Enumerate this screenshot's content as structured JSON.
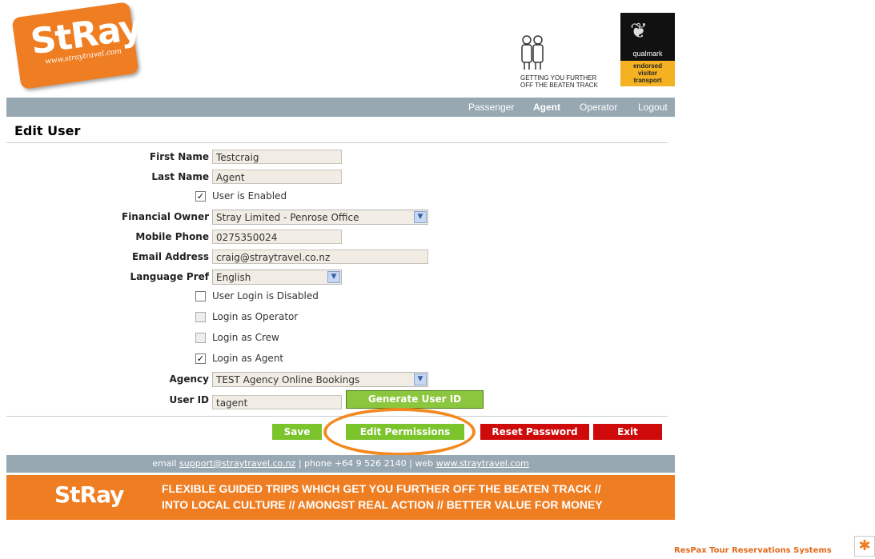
{
  "header": {
    "logo_text": "StRay",
    "logo_url": "www.straytravel.com",
    "tagline_line1": "GETTING YOU FURTHER",
    "tagline_line2": "OFF THE BEATEN TRACK",
    "qualmark_name": "qualmark",
    "qualmark_line1": "endorsed",
    "qualmark_line2": "visitor",
    "qualmark_line3": "transport"
  },
  "nav": {
    "items": [
      {
        "label": "Passenger"
      },
      {
        "label": "Agent"
      },
      {
        "label": "Operator"
      },
      {
        "label": "Logout"
      }
    ],
    "active": "Agent"
  },
  "page": {
    "title": "Edit User"
  },
  "form": {
    "first_name": {
      "label": "First Name",
      "value": "Testcraig"
    },
    "last_name": {
      "label": "Last Name",
      "value": "Agent"
    },
    "user_enabled": {
      "label": "User is Enabled",
      "checked": true
    },
    "financial_owner": {
      "label": "Financial Owner",
      "value": "Stray Limited - Penrose Office"
    },
    "mobile_phone": {
      "label": "Mobile Phone",
      "value": "0275350024"
    },
    "email": {
      "label": "Email Address",
      "value": "craig@straytravel.co.nz"
    },
    "language": {
      "label": "Language Pref",
      "value": "English"
    },
    "login_disabled": {
      "label": "User Login is Disabled",
      "checked": false
    },
    "login_operator": {
      "label": "Login as Operator",
      "checked": false
    },
    "login_crew": {
      "label": "Login as Crew",
      "checked": false
    },
    "login_agent": {
      "label": "Login as Agent",
      "checked": true
    },
    "agency": {
      "label": "Agency",
      "value": "TEST Agency Online Bookings"
    },
    "user_id": {
      "label": "User ID",
      "value": "tagent"
    },
    "generate_label": "Generate User ID"
  },
  "actions": {
    "save": "Save",
    "edit_permissions": "Edit Permissions",
    "reset_password": "Reset Password",
    "exit": "Exit"
  },
  "footer": {
    "email_prefix": "email ",
    "email": "support@straytravel.co.nz",
    "phone_text": " | phone +64 9 526 2140 | web ",
    "web": "www.straytravel.com",
    "logo_text": "StRay",
    "slogan_line1": "FLEXIBLE GUIDED TRIPS WHICH GET YOU FURTHER OFF THE BEATEN TRACK //",
    "slogan_line2": "INTO LOCAL CULTURE // AMONGST REAL ACTION // BETTER VALUE FOR MONEY",
    "credit": "ResPax Tour Reservations Systems"
  },
  "colors": {
    "brand_orange": "#ef7d22",
    "nav_grey": "#97a8b3",
    "button_green": "#7cc42c",
    "button_red": "#cf0a0a",
    "input_bg": "#f1ede4"
  }
}
